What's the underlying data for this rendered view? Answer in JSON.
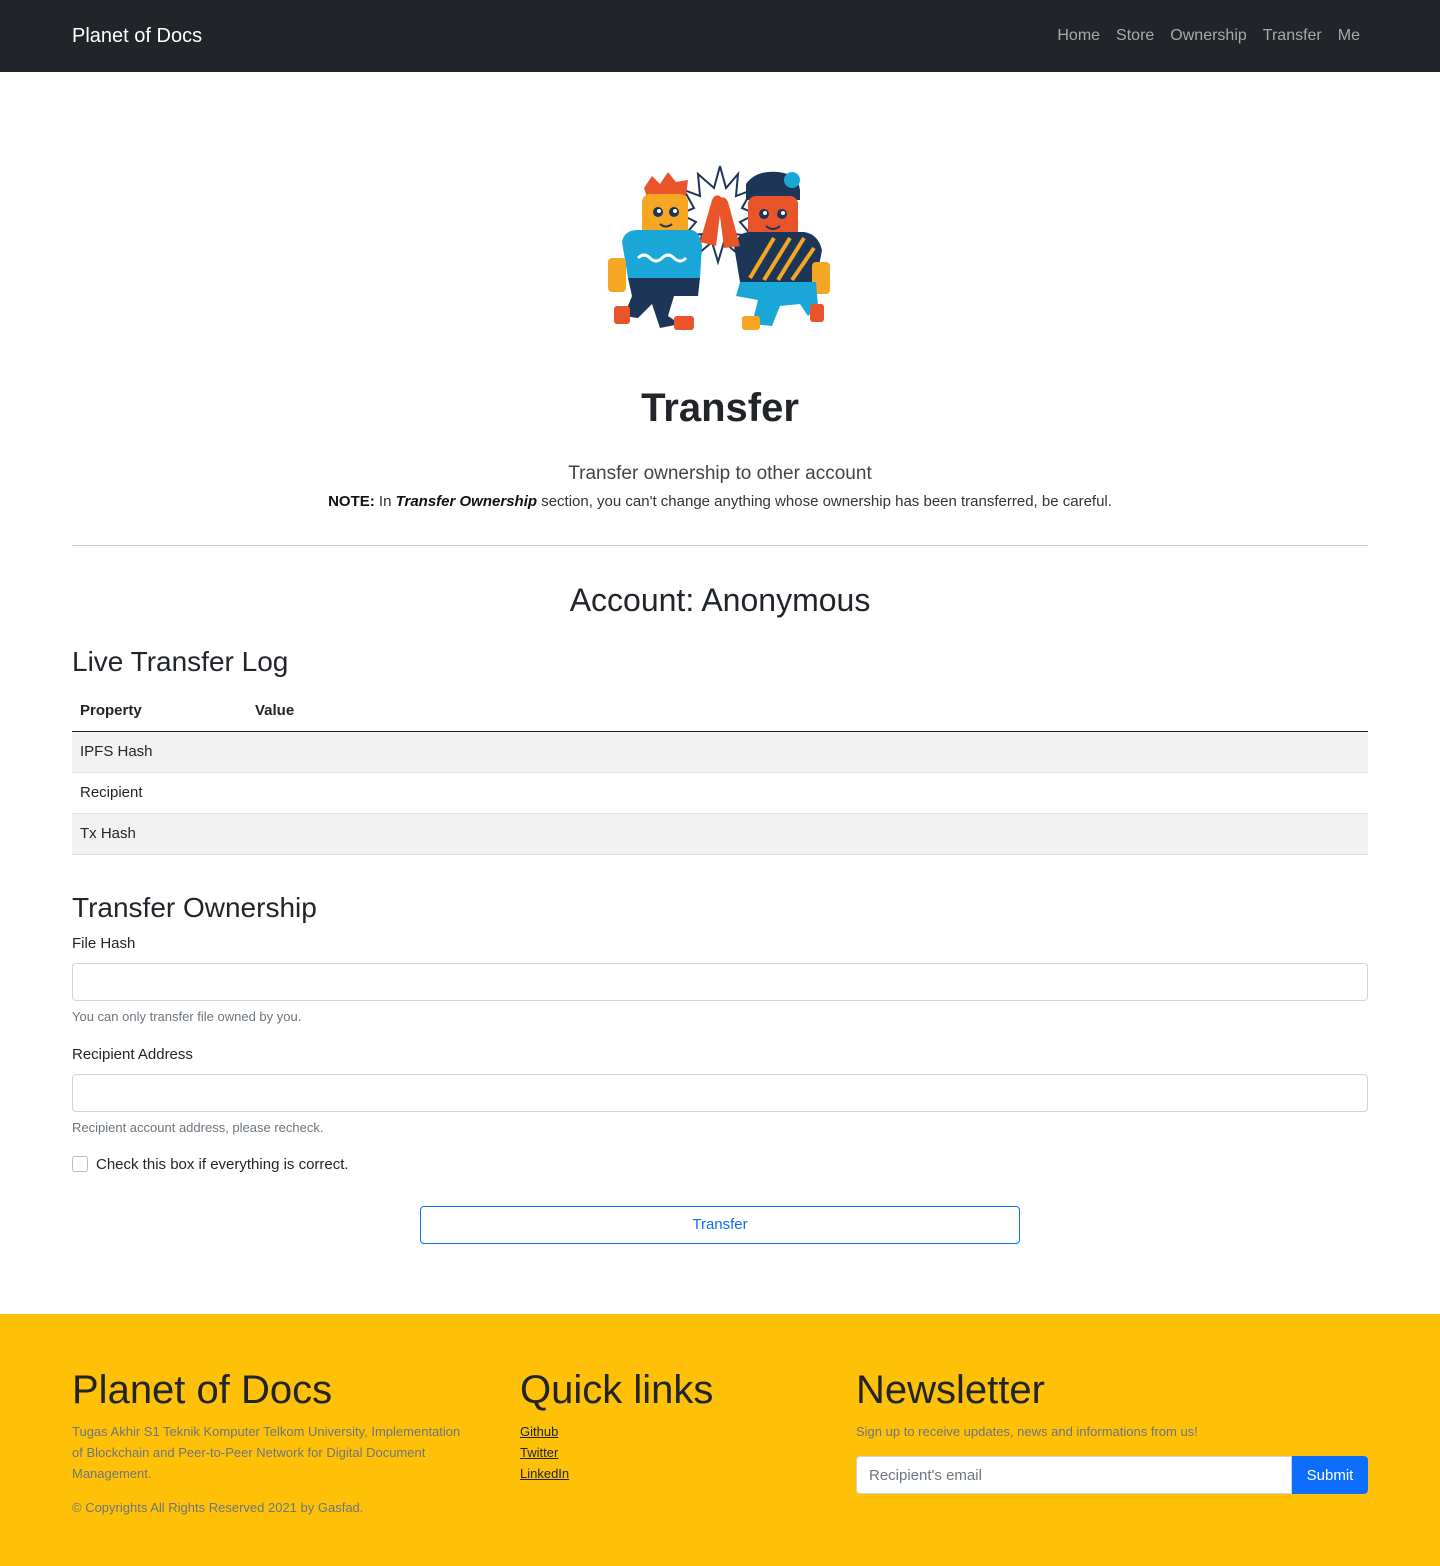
{
  "navbar": {
    "brand": "Planet of Docs",
    "links": [
      "Home",
      "Store",
      "Ownership",
      "Transfer",
      "Me"
    ]
  },
  "hero": {
    "title": "Transfer",
    "lead": "Transfer ownership to other account",
    "note_label": "NOTE:",
    "note_pre": " In ",
    "note_emphasis": "Transfer Ownership",
    "note_post": " section, you can't change anything whose ownership has been transferred, be careful."
  },
  "account": {
    "text": "Account: Anonymous"
  },
  "log": {
    "title": "Live Transfer Log",
    "headers": [
      "Property",
      "Value"
    ],
    "rows": [
      {
        "property": "IPFS Hash",
        "value": ""
      },
      {
        "property": "Recipient",
        "value": ""
      },
      {
        "property": "Tx Hash",
        "value": ""
      }
    ]
  },
  "form": {
    "title": "Transfer Ownership",
    "file_hash_label": "File Hash",
    "file_hash_value": "",
    "file_hash_help": "You can only transfer file owned by you.",
    "recipient_label": "Recipient Address",
    "recipient_value": "",
    "recipient_help": "Recipient account address, please recheck.",
    "checkbox_label": "Check this box if everything is correct.",
    "submit_label": "Transfer"
  },
  "footer": {
    "brand": "Planet of Docs",
    "description": "Tugas Akhir S1 Teknik Komputer Telkom University, Implementation of Blockchain and Peer-to-Peer Network for Digital Document Management.",
    "copyright": "© Copyrights All Rights Reserved 2021 by Gasfad.",
    "quick_links_title": "Quick links",
    "quick_links": [
      "Github",
      "Twitter",
      "LinkedIn"
    ],
    "newsletter_title": "Newsletter",
    "newsletter_text": "Sign up to receive updates, news and informations from us!",
    "email_placeholder": "Recipient's email",
    "submit_label": "Submit"
  },
  "colors": {
    "navbar": "#212529",
    "footer": "#ffc107",
    "primary": "#0d6efd"
  }
}
